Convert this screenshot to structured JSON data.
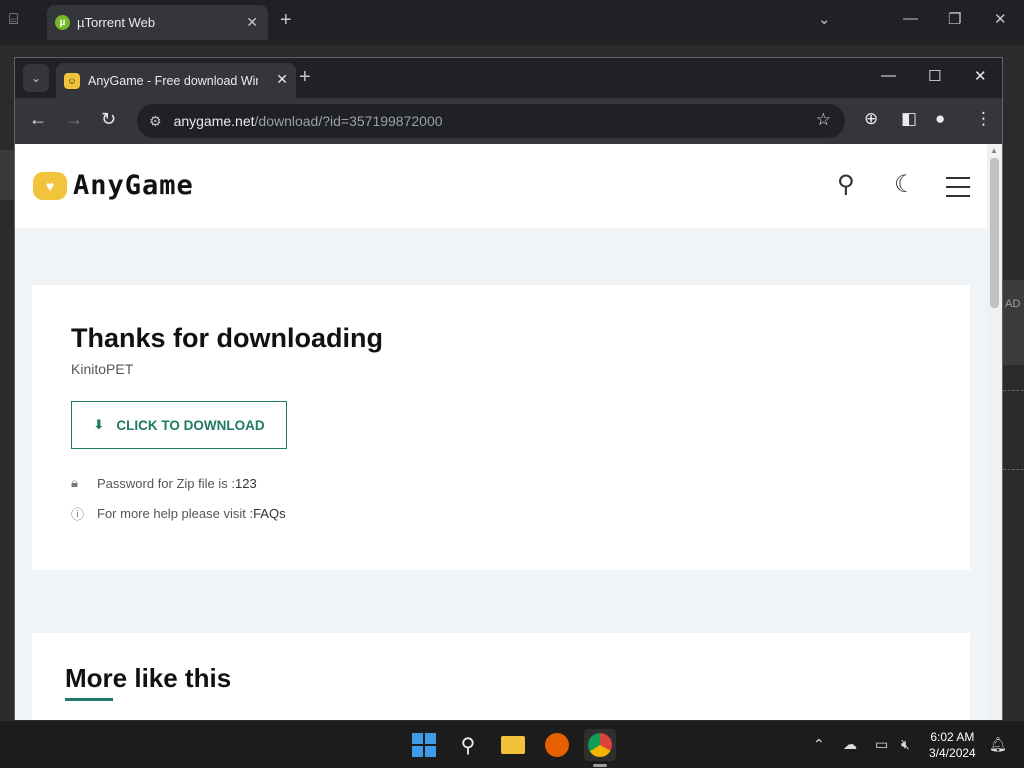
{
  "background_window": {
    "tab_title": "µTorrent Web",
    "tab_icon_letter": "µ",
    "side_label": "AD"
  },
  "browser": {
    "tab_title": "AnyGame - Free download Win",
    "url_domain": "anygame.net",
    "url_path": "/download/?id=357199872000"
  },
  "site": {
    "logo_text": "AnyGame",
    "logo_mark": "♥"
  },
  "download_card": {
    "title": "Thanks for downloading",
    "game_name": "KinitoPET",
    "button_label": "CLICK TO DOWNLOAD",
    "password_label": "Password for Zip file is : ",
    "password_value": "123",
    "help_label": "For more help please visit : ",
    "help_link": "FAQs"
  },
  "more_section": {
    "title": "More like this"
  },
  "taskbar": {
    "time": "6:02 AM",
    "date": "3/4/2024"
  },
  "colors": {
    "accent": "#1e7a64",
    "logo": "#f2c43c"
  }
}
